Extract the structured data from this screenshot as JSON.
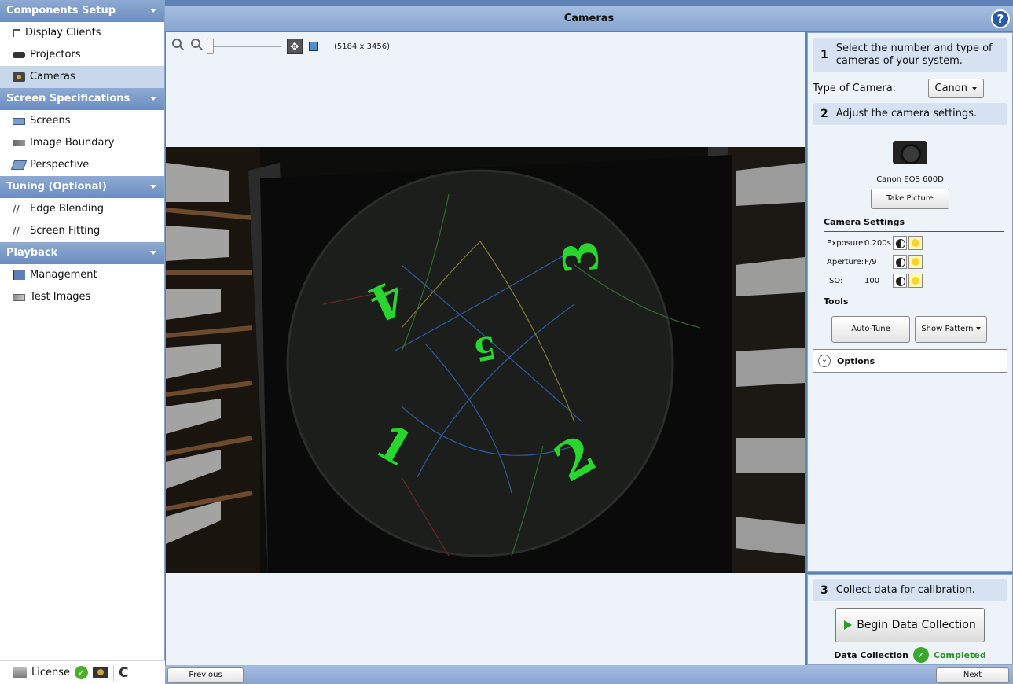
{
  "sidebar": {
    "sections": [
      {
        "title": "Components Setup",
        "items": [
          {
            "label": "Display Clients",
            "icon": "display-clients-icon"
          },
          {
            "label": "Projectors",
            "icon": "projector-icon"
          },
          {
            "label": "Cameras",
            "icon": "camera-icon",
            "selected": true
          }
        ]
      },
      {
        "title": "Screen Specifications",
        "items": [
          {
            "label": "Screens",
            "icon": "screen-icon"
          },
          {
            "label": "Image Boundary",
            "icon": "image-boundary-icon"
          },
          {
            "label": "Perspective",
            "icon": "perspective-icon"
          }
        ]
      },
      {
        "title": "Tuning (Optional)",
        "items": [
          {
            "label": "Edge Blending",
            "icon": "edge-blending-icon"
          },
          {
            "label": "Screen Fitting",
            "icon": "screen-fitting-icon"
          }
        ]
      },
      {
        "title": "Playback",
        "items": [
          {
            "label": "Management",
            "icon": "management-icon"
          },
          {
            "label": "Test Images",
            "icon": "test-images-icon"
          }
        ]
      }
    ],
    "license_label": "License"
  },
  "header": {
    "title": "Cameras",
    "help_icon": "?"
  },
  "viewer": {
    "resolution": "(5184 x 3456)",
    "zoom_level": 0,
    "projector_labels": [
      "1",
      "2",
      "3",
      "4",
      "5"
    ]
  },
  "right_panel": {
    "step1": {
      "num": "1",
      "text": "Select the number and type of cameras of your system."
    },
    "camera_type_label": "Type of Camera:",
    "camera_type_value": "Canon",
    "step2": {
      "num": "2",
      "text": "Adjust the camera settings."
    },
    "camera_model": "Canon EOS 600D",
    "take_picture": "Take Picture",
    "camera_settings_title": "Camera Settings",
    "settings": [
      {
        "label": "Exposure:",
        "value": "0.200s"
      },
      {
        "label": "Aperture:",
        "value": "F/9"
      },
      {
        "label": "ISO:",
        "value": "100"
      }
    ],
    "tools_title": "Tools",
    "auto_tune": "Auto-Tune",
    "show_pattern": "Show Pattern",
    "options": "Options",
    "step3": {
      "num": "3",
      "text": "Collect data for calibration."
    },
    "begin_data_collection": "Begin Data Collection",
    "data_collection_label": "Data Collection",
    "data_collection_status": "Completed"
  },
  "footer": {
    "previous": "Previous",
    "next": "Next"
  },
  "colors": {
    "header_blue": "#87a5d1",
    "selected_item": "#c9d7ea",
    "projector_green": "#29d62e",
    "success_green": "#3aa82e"
  }
}
